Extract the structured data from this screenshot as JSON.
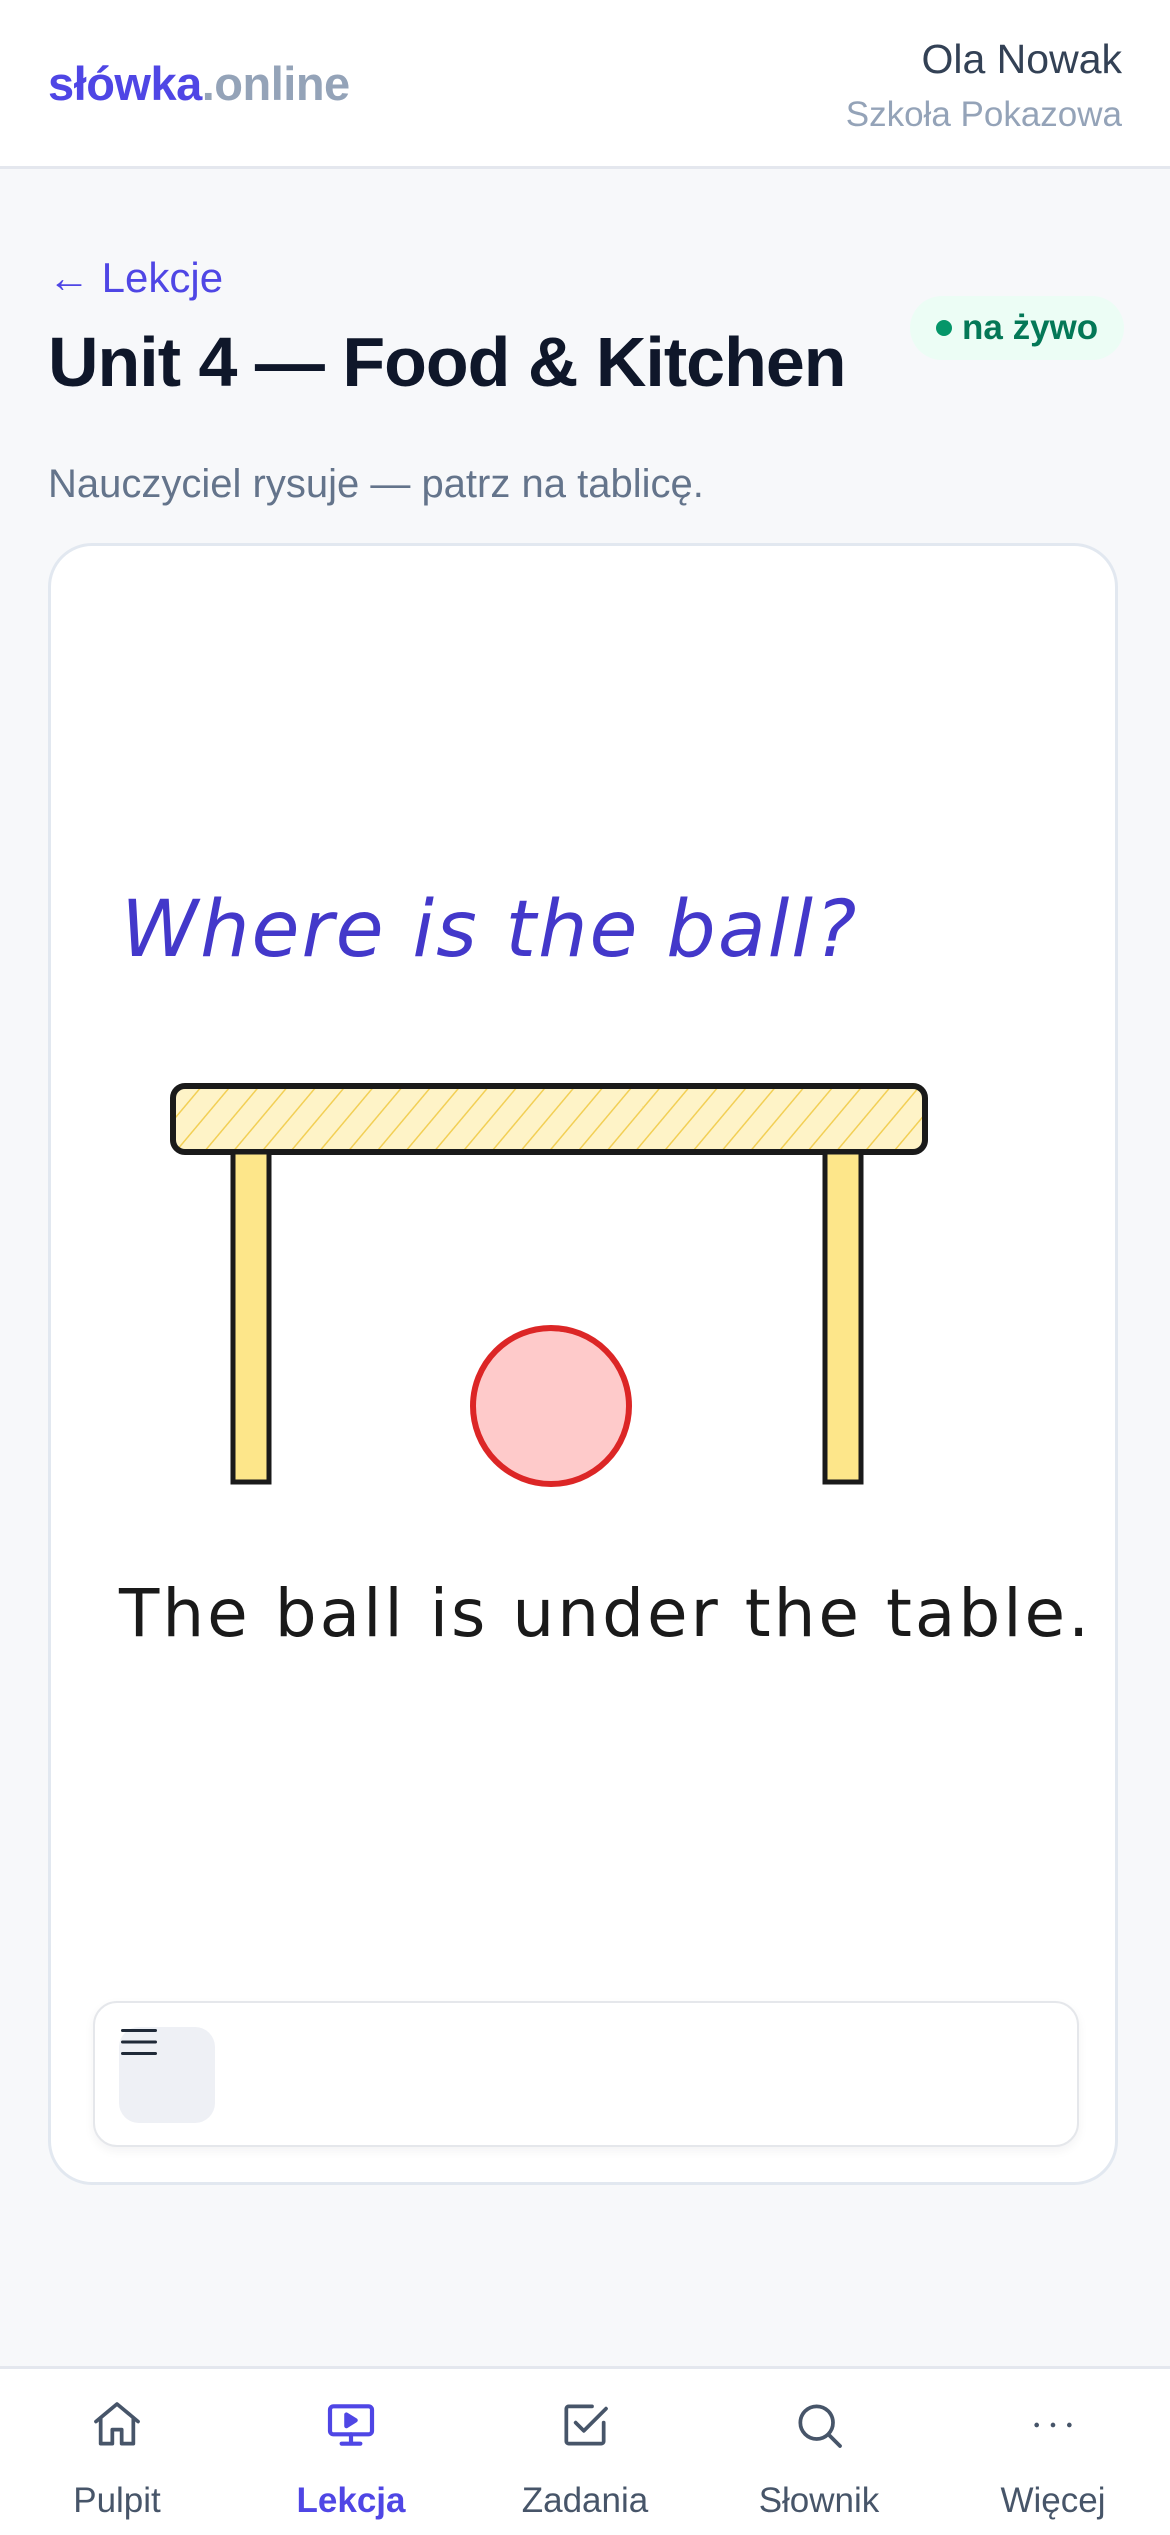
{
  "header": {
    "brand_primary": "słówka",
    "brand_secondary": ".online",
    "user_name": "Ola Nowak",
    "user_school": "Szkoła Pokazowa"
  },
  "lesson": {
    "back_label": "← Lekcje",
    "title": "Unit 4 — Food & Kitchen",
    "status_label": "na żywo",
    "subtitle": "Nauczyciel rysuje — patrz na tablicę."
  },
  "board": {
    "question": "Where is the ball?",
    "answer": "The ball is under the table.",
    "colors": {
      "question": "#4338ca",
      "table_fill": "#fde68a",
      "outline": "#1a1a1a",
      "ball_fill": "#fecaca",
      "ball_stroke": "#dc2626"
    },
    "menu_icon": "hamburger-icon"
  },
  "nav": {
    "items": [
      {
        "label": "Pulpit",
        "icon": "home-icon"
      },
      {
        "label": "Lekcja",
        "icon": "presentation-icon"
      },
      {
        "label": "Zadania",
        "icon": "checkbox-icon"
      },
      {
        "label": "Słownik",
        "icon": "search-icon"
      },
      {
        "label": "Więcej",
        "icon": "more-icon"
      }
    ],
    "active_index": 1
  },
  "theme": {
    "accent": "#4f46e5",
    "live_green": "#047857"
  }
}
